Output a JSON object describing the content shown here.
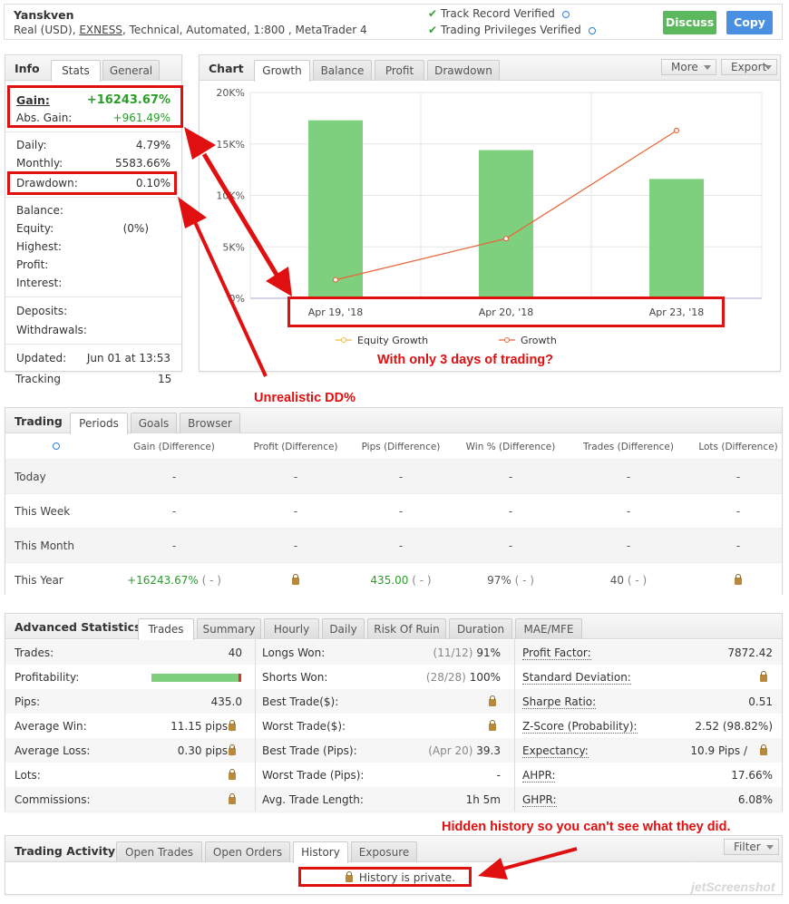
{
  "header": {
    "name": "Yanskven",
    "broker": "EXNESS",
    "desc_prefix": "Real (USD), ",
    "desc_suffix": ", Technical, Automated, 1:800 , MetaTrader 4",
    "track_record": "Track Record Verified",
    "privileges": "Trading Privileges Verified",
    "discuss": "Discuss",
    "copy": "Copy",
    "colors": {
      "discuss": "#5cb85c",
      "copy": "#4a90e2"
    }
  },
  "info": {
    "title": "Info",
    "tabs": [
      "Stats",
      "General"
    ],
    "gain_label": "Gain:",
    "gain_value": "+16243.67%",
    "abs_gain_label": "Abs. Gain:",
    "abs_gain_value": "+961.49%",
    "daily_label": "Daily:",
    "daily_value": "4.79%",
    "monthly_label": "Monthly:",
    "monthly_value": "5583.66%",
    "drawdown_label": "Drawdown:",
    "drawdown_value": "0.10%",
    "balance_label": "Balance:",
    "equity_label": "Equity:",
    "equity_value": "(0%)",
    "highest_label": "Highest:",
    "profit_label": "Profit:",
    "interest_label": "Interest:",
    "deposits_label": "Deposits:",
    "withdrawals_label": "Withdrawals:",
    "updated_label": "Updated:",
    "updated_value": "Jun 01 at 13:53",
    "tracking_label": "Tracking",
    "tracking_value": "15"
  },
  "chart_panel": {
    "title": "Chart",
    "tabs": [
      "Growth",
      "Balance",
      "Profit",
      "Drawdown"
    ],
    "more": "More",
    "export": "Export"
  },
  "chart_data": {
    "type": "bar",
    "categories": [
      "Apr 19, '18",
      "Apr 20, '18",
      "Apr 23, '18"
    ],
    "series": [
      {
        "name": "Equity Growth",
        "values": [
          17300,
          14400,
          11600
        ],
        "color": "#7ed07e"
      },
      {
        "name": "Growth",
        "values": [
          1800,
          5800,
          16300
        ],
        "color": "#e8673c"
      }
    ],
    "yticks": [
      "20K%",
      "15K%",
      "10K%",
      "5K%",
      "0%"
    ],
    "ylim": [
      0,
      20000
    ],
    "grid": true,
    "legend": "bottom"
  },
  "annotations": {
    "three_days": "With only 3 days of trading?",
    "dd": "Unrealistic DD%",
    "hidden": "Hidden history so you can't see what they did."
  },
  "trading": {
    "title": "Trading",
    "tabs": [
      "Periods",
      "Goals",
      "Browser"
    ],
    "headers": [
      "Gain (Difference)",
      "Profit (Difference)",
      "Pips (Difference)",
      "Win % (Difference)",
      "Trades (Difference)",
      "Lots (Difference)"
    ],
    "rows": [
      {
        "label": "Today",
        "gain": "-",
        "profit": "-",
        "pips": "-",
        "win": "-",
        "trades": "-",
        "lots": "-"
      },
      {
        "label": "This Week",
        "gain": "-",
        "profit": "-",
        "pips": "-",
        "win": "-",
        "trades": "-",
        "lots": "-"
      },
      {
        "label": "This Month",
        "gain": "-",
        "profit": "-",
        "pips": "-",
        "win": "-",
        "trades": "-",
        "lots": "-"
      },
      {
        "label": "This Year",
        "gain": "+16243.67%",
        "gain_diff": "( - )",
        "pips": "435.00",
        "pips_diff": "( - )",
        "win": "97%",
        "win_diff": "( - )",
        "trades": "40",
        "trades_diff": "( - )"
      }
    ]
  },
  "advanced": {
    "title": "Advanced Statistics",
    "tabs": [
      "Trades",
      "Summary",
      "Hourly",
      "Daily",
      "Risk Of Ruin",
      "Duration",
      "MAE/MFE"
    ],
    "col1": [
      {
        "label": "Trades:",
        "value": "40"
      },
      {
        "label": "Profitability:",
        "value": "",
        "profitability": 0.97
      },
      {
        "label": "Pips:",
        "value": "435.0"
      },
      {
        "label": "Average Win:",
        "value": "11.15 pips /"
      },
      {
        "label": "Average Loss:",
        "value": "0.30 pips /"
      },
      {
        "label": "Lots:",
        "value": ""
      },
      {
        "label": "Commissions:",
        "value": ""
      }
    ],
    "col2": [
      {
        "label": "Longs Won:",
        "sub": "(11/12)",
        "value": "91%"
      },
      {
        "label": "Shorts Won:",
        "sub": "(28/28)",
        "value": "100%"
      },
      {
        "label": "Best Trade($):",
        "sub": "",
        "value": ""
      },
      {
        "label": "Worst Trade($):",
        "sub": "",
        "value": ""
      },
      {
        "label": "Best Trade (Pips):",
        "sub": "(Apr 20)",
        "value": "39.3"
      },
      {
        "label": "Worst Trade (Pips):",
        "sub": "",
        "value": "-"
      },
      {
        "label": "Avg. Trade Length:",
        "sub": "",
        "value": "1h 5m"
      }
    ],
    "col3": [
      {
        "label": "Profit Factor:",
        "value": "7872.42"
      },
      {
        "label": "Standard Deviation:",
        "value": ""
      },
      {
        "label": "Sharpe Ratio:",
        "value": "0.51"
      },
      {
        "label": "Z-Score (Probability):",
        "value": "2.52 (98.82%)"
      },
      {
        "label": "Expectancy:",
        "value": "10.9 Pips /"
      },
      {
        "label": "AHPR:",
        "value": "17.66%"
      },
      {
        "label": "GHPR:",
        "value": "6.08%"
      }
    ]
  },
  "activity": {
    "title": "Trading Activity",
    "tabs": [
      "Open Trades",
      "Open Orders",
      "History",
      "Exposure"
    ],
    "filter": "Filter",
    "private": "History is private.",
    "watermark": "jetScreenshot"
  }
}
